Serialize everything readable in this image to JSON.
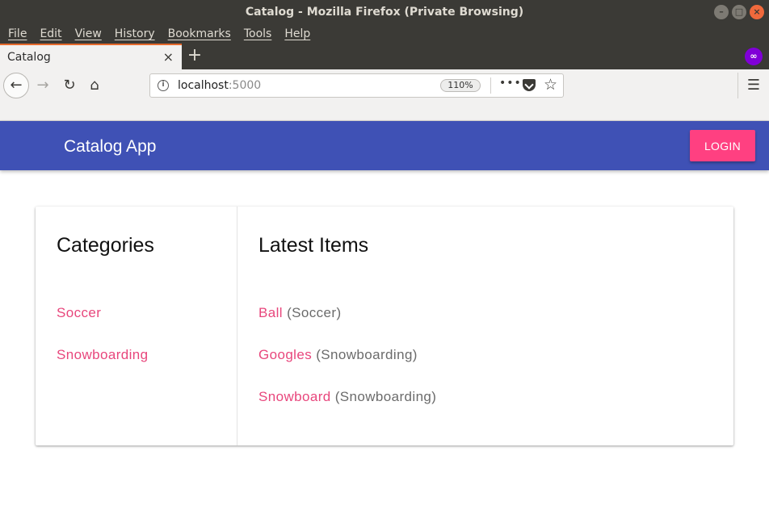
{
  "window": {
    "title": "Catalog - Mozilla Firefox (Private Browsing)",
    "controls": [
      "–",
      "□",
      "×"
    ]
  },
  "menubar": {
    "items": [
      "File",
      "Edit",
      "View",
      "History",
      "Bookmarks",
      "Tools",
      "Help"
    ]
  },
  "tabs": [
    {
      "label": "Catalog",
      "active": true
    }
  ],
  "tab_icons": {
    "close": "×",
    "new_tab": "+",
    "private": "∞"
  },
  "toolbar": {
    "back": "←",
    "forward": "→",
    "reload": "↻",
    "home": "⌂",
    "url_host": "localhost",
    "url_port": ":5000",
    "zoom": "110%",
    "more": "•••",
    "star": "☆",
    "menu": "☰"
  },
  "app": {
    "title": "Catalog App",
    "login_label": "LOGIN",
    "brand_color": "#3f51b5",
    "accent_color": "#ff4081"
  },
  "categories": {
    "heading": "Categories",
    "items": [
      "Soccer",
      "Snowboarding"
    ]
  },
  "latest": {
    "heading": "Latest Items",
    "items": [
      {
        "name": "Ball",
        "category": "(Soccer)"
      },
      {
        "name": "Googles",
        "category": "(Snowboarding)"
      },
      {
        "name": "Snowboard",
        "category": "(Snowboarding)"
      }
    ]
  }
}
